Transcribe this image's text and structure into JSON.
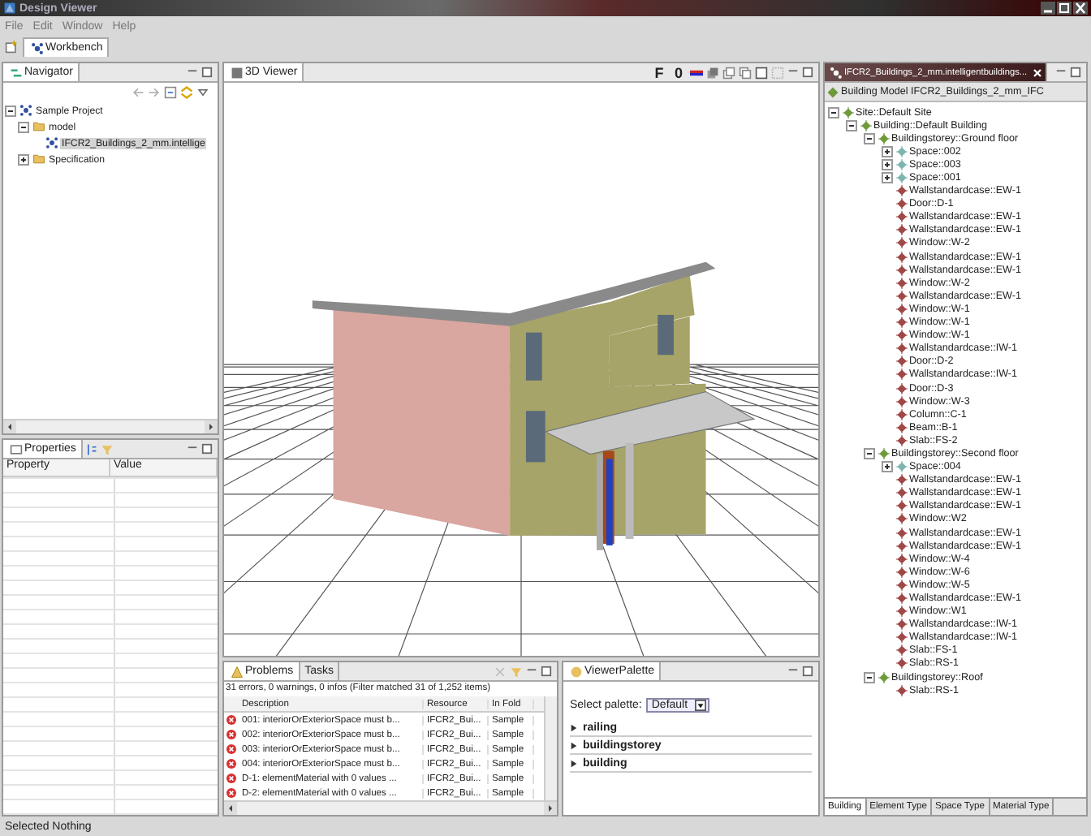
{
  "window": {
    "title": "Design Viewer",
    "menu": [
      "File",
      "Edit",
      "Window",
      "Help"
    ]
  },
  "perspective_tab": "Workbench",
  "navigator": {
    "title": "Navigator",
    "tree": [
      {
        "label": "Sample Project",
        "kind": "project",
        "expanded": true,
        "children": [
          {
            "label": "model",
            "kind": "folder",
            "expanded": true,
            "children": [
              {
                "label": "IFCR2_Buildings_2_mm.intellige",
                "kind": "model",
                "selected": true
              }
            ]
          },
          {
            "label": "Specification",
            "kind": "folder",
            "expanded": false
          }
        ]
      }
    ]
  },
  "properties": {
    "title": "Properties",
    "columns": [
      "Property",
      "Value"
    ]
  },
  "viewer": {
    "title": "3D Viewer",
    "tools": [
      "F",
      "0"
    ]
  },
  "problems": {
    "tabs": [
      {
        "label": "Problems",
        "selected": true
      },
      {
        "label": "Tasks",
        "selected": false
      }
    ],
    "summary": "31 errors, 0 warnings, 0 infos (Filter matched 31 of 1,252 items)",
    "columns": [
      "Description",
      "Resource",
      "In Fold"
    ],
    "rows": [
      [
        "001: interiorOrExteriorSpace must b...",
        "IFCR2_Bui...",
        "Sample"
      ],
      [
        "002: interiorOrExteriorSpace must b...",
        "IFCR2_Bui...",
        "Sample"
      ],
      [
        "003: interiorOrExteriorSpace must b...",
        "IFCR2_Bui...",
        "Sample"
      ],
      [
        "004: interiorOrExteriorSpace must b...",
        "IFCR2_Bui...",
        "Sample"
      ],
      [
        "D-1: elementMaterial with 0 values ...",
        "IFCR2_Bui...",
        "Sample"
      ],
      [
        "D-2: elementMaterial with 0 values ...",
        "IFCR2_Bui...",
        "Sample"
      ]
    ]
  },
  "palette": {
    "title": "ViewerPalette",
    "select_label": "Select palette:",
    "select_value": "Default",
    "groups": [
      "railing",
      "buildingstorey",
      "building"
    ]
  },
  "model_panel": {
    "tab_title": "IFCR2_Buildings_2_mm.intelligentbuildings...",
    "header": "Building Model IFCR2_Buildings_2_mm_IFC",
    "tree": [
      {
        "label": "Site::Default Site",
        "kind": "spatial",
        "expanded": true,
        "children": [
          {
            "label": "Building::Default Building",
            "kind": "spatial",
            "expanded": true,
            "children": [
              {
                "label": "Buildingstorey::Ground floor",
                "kind": "spatial",
                "expanded": true,
                "children": [
                  {
                    "label": "Space::002",
                    "kind": "space",
                    "expanded": false
                  },
                  {
                    "label": "Space::003",
                    "kind": "space",
                    "expanded": false
                  },
                  {
                    "label": "Space::001",
                    "kind": "space",
                    "expanded": false
                  },
                  {
                    "label": "Wallstandardcase::EW-1",
                    "kind": "element"
                  },
                  {
                    "label": "Door::D-1",
                    "kind": "element"
                  },
                  {
                    "label": "Wallstandardcase::EW-1",
                    "kind": "element"
                  },
                  {
                    "label": "Wallstandardcase::EW-1",
                    "kind": "element"
                  },
                  {
                    "label": "Window::W-2",
                    "kind": "element"
                  },
                  {
                    "label": "Wallstandardcase::EW-1",
                    "kind": "element"
                  },
                  {
                    "label": "Wallstandardcase::EW-1",
                    "kind": "element"
                  },
                  {
                    "label": "Window::W-2",
                    "kind": "element"
                  },
                  {
                    "label": "Wallstandardcase::EW-1",
                    "kind": "element"
                  },
                  {
                    "label": "Window::W-1",
                    "kind": "element"
                  },
                  {
                    "label": "Window::W-1",
                    "kind": "element"
                  },
                  {
                    "label": "Window::W-1",
                    "kind": "element"
                  },
                  {
                    "label": "Wallstandardcase::IW-1",
                    "kind": "element"
                  },
                  {
                    "label": "Door::D-2",
                    "kind": "element"
                  },
                  {
                    "label": "Wallstandardcase::IW-1",
                    "kind": "element"
                  },
                  {
                    "label": "Door::D-3",
                    "kind": "element"
                  },
                  {
                    "label": "Window::W-3",
                    "kind": "element"
                  },
                  {
                    "label": "Column::C-1",
                    "kind": "element"
                  },
                  {
                    "label": "Beam::B-1",
                    "kind": "element"
                  },
                  {
                    "label": "Slab::FS-2",
                    "kind": "element"
                  }
                ]
              },
              {
                "label": "Buildingstorey::Second floor",
                "kind": "spatial",
                "expanded": true,
                "children": [
                  {
                    "label": "Space::004",
                    "kind": "space",
                    "expanded": false
                  },
                  {
                    "label": "Wallstandardcase::EW-1",
                    "kind": "element"
                  },
                  {
                    "label": "Wallstandardcase::EW-1",
                    "kind": "element"
                  },
                  {
                    "label": "Wallstandardcase::EW-1",
                    "kind": "element"
                  },
                  {
                    "label": "Window::W2",
                    "kind": "element"
                  },
                  {
                    "label": "Wallstandardcase::EW-1",
                    "kind": "element"
                  },
                  {
                    "label": "Wallstandardcase::EW-1",
                    "kind": "element"
                  },
                  {
                    "label": "Window::W-4",
                    "kind": "element"
                  },
                  {
                    "label": "Window::W-6",
                    "kind": "element"
                  },
                  {
                    "label": "Window::W-5",
                    "kind": "element"
                  },
                  {
                    "label": "Wallstandardcase::EW-1",
                    "kind": "element"
                  },
                  {
                    "label": "Window::W1",
                    "kind": "element"
                  },
                  {
                    "label": "Wallstandardcase::IW-1",
                    "kind": "element"
                  },
                  {
                    "label": "Wallstandardcase::IW-1",
                    "kind": "element"
                  },
                  {
                    "label": "Slab::FS-1",
                    "kind": "element"
                  },
                  {
                    "label": "Slab::RS-1",
                    "kind": "element"
                  }
                ]
              },
              {
                "label": "Buildingstorey::Roof",
                "kind": "spatial",
                "expanded": true,
                "children": [
                  {
                    "label": "Slab::RS-1",
                    "kind": "element"
                  }
                ]
              }
            ]
          }
        ]
      }
    ],
    "tabs": [
      {
        "label": "Building",
        "selected": true
      },
      {
        "label": "Element Type",
        "selected": false
      },
      {
        "label": "Space Type",
        "selected": false
      },
      {
        "label": "Material Type",
        "selected": false
      }
    ]
  },
  "status_bar": "Selected Nothing"
}
